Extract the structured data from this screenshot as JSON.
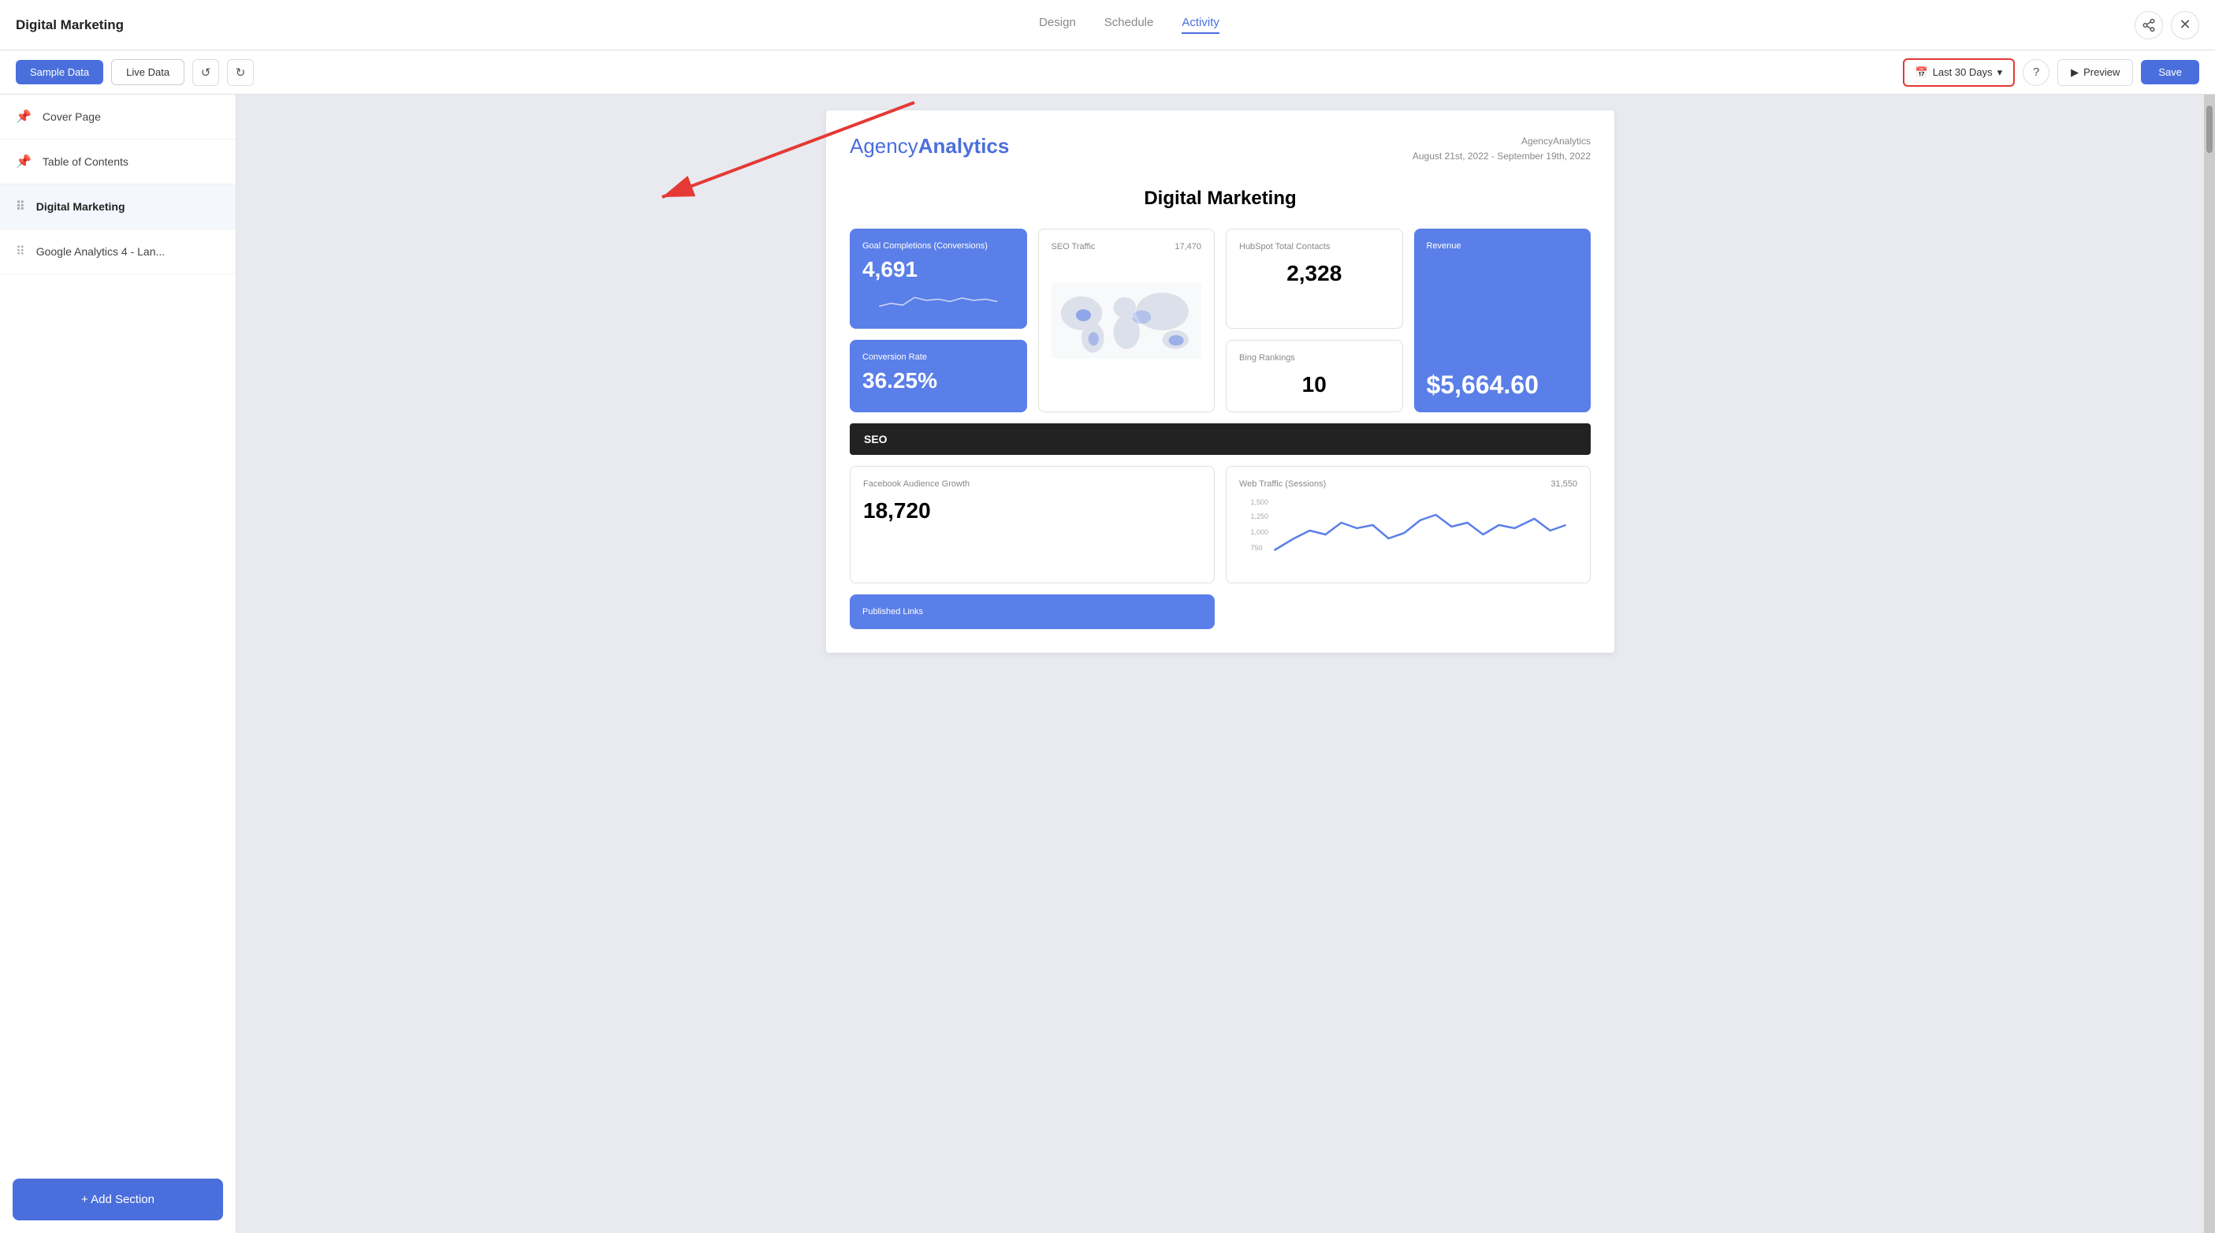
{
  "app": {
    "title": "Digital Marketing"
  },
  "topbar": {
    "title": "Digital Marketing",
    "tabs": [
      {
        "label": "Design",
        "active": false
      },
      {
        "label": "Schedule",
        "active": false
      },
      {
        "label": "Activity",
        "active": true
      }
    ],
    "share_icon": "⬡",
    "close_icon": "✕"
  },
  "subtoolbar": {
    "sample_data_label": "Sample Data",
    "live_data_label": "Live Data",
    "undo_label": "↺",
    "redo_label": "↻",
    "date_label": "Last 30 Days",
    "help_label": "?",
    "preview_label": "Preview",
    "save_label": "Save"
  },
  "sidebar": {
    "items": [
      {
        "label": "Cover Page",
        "icon": "pin",
        "active": false
      },
      {
        "label": "Table of Contents",
        "icon": "pin",
        "active": false
      },
      {
        "label": "Digital Marketing",
        "icon": "drag",
        "active": true
      },
      {
        "label": "Google Analytics 4 - Lan...",
        "icon": "drag",
        "active": false
      }
    ],
    "add_section_label": "+ Add Section"
  },
  "report": {
    "logo_agency": "Agency",
    "logo_analytics": "Analytics",
    "meta_company": "AgencyAnalytics",
    "meta_date": "August 21st, 2022 - September 19th, 2022",
    "title": "Digital Marketing",
    "widgets": [
      {
        "type": "blue",
        "title": "Goal Completions (Conversions)",
        "value": "4,691",
        "has_sparkline": true
      },
      {
        "type": "map",
        "title": "SEO Traffic",
        "value": "17,470"
      },
      {
        "type": "white",
        "title": "HubSpot Total Contacts",
        "value": "2,328"
      },
      {
        "type": "revenue",
        "title": "Revenue",
        "value": "$5,664.60"
      },
      {
        "type": "blue",
        "title": "Conversion Rate",
        "value": "36.25%",
        "has_sparkline": false
      },
      {
        "type": "white",
        "title": "Bing Rankings",
        "value": "10"
      }
    ],
    "seo_label": "SEO",
    "facebook": {
      "title": "Facebook Audience Growth",
      "value": "18,720"
    },
    "traffic": {
      "title": "Web Traffic (Sessions)",
      "value": "31,550",
      "y_labels": [
        "1,500",
        "1,250",
        "1,000",
        "750"
      ]
    },
    "published": {
      "title": "Published Links"
    }
  }
}
